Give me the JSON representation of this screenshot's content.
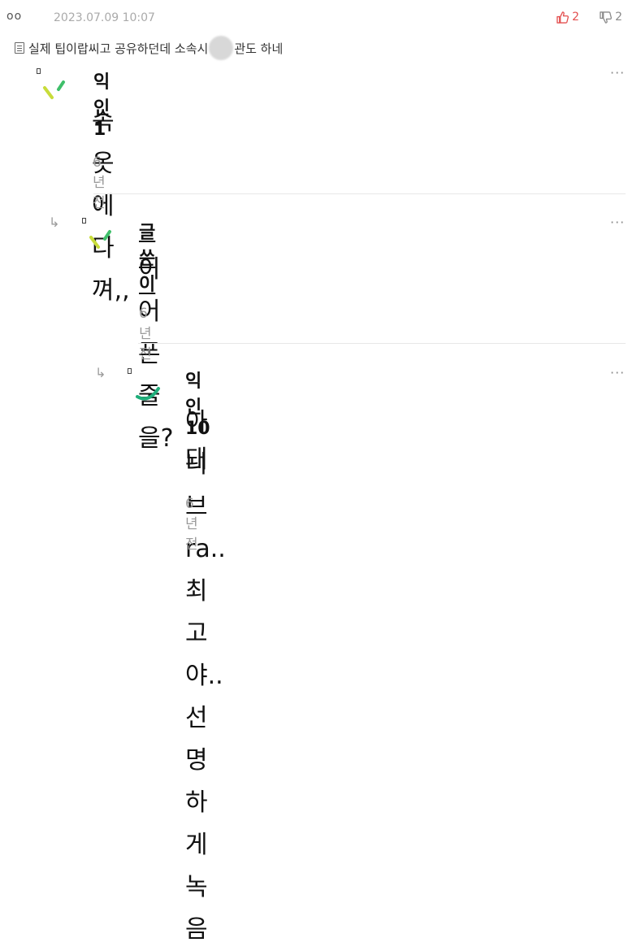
{
  "header": {
    "author_dots": "oo",
    "date": "2023.07.09 10:07",
    "likes": "2",
    "dislikes": "2"
  },
  "post": {
    "title_prefix": "실제 팁이랍씨고 공유하던데 소속시",
    "title_suffix": "관도 하네"
  },
  "comments": [
    {
      "nick": "익인1",
      "text": "속옷에다 껴,,",
      "time": "6년 전",
      "more": "···"
    },
    {
      "nick": "글쓴이",
      "text": "이어폰 줄을?",
      "time": "6년 전",
      "more": "···"
    },
    {
      "nick": "익인10",
      "text_line1": "아니 브ra.. 최고야..선명하게 녹음",
      "text_line2": "돼",
      "time": "6년 전",
      "more": "···"
    }
  ],
  "colors": {
    "like_red": "#e34f4f",
    "avatar_lime": "#c8dc3a",
    "avatar_green": "#3fbf6a",
    "avatar_teal": "#1fae7a"
  }
}
